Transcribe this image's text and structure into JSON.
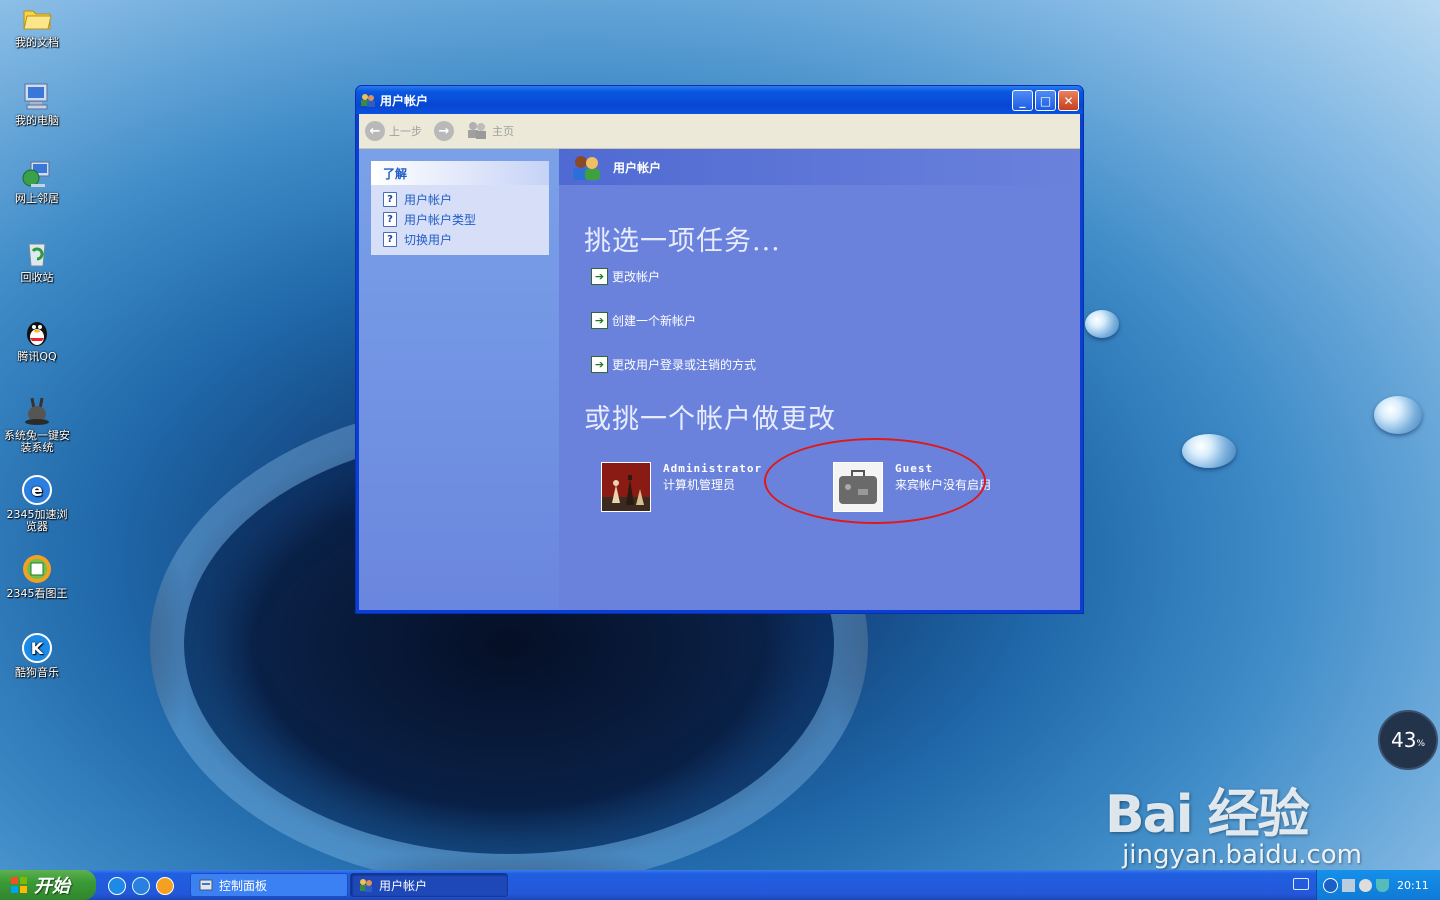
{
  "desktop": {
    "icons": [
      {
        "label": "我的文档"
      },
      {
        "label": "我的电脑"
      },
      {
        "label": "网上邻居"
      },
      {
        "label": "回收站"
      },
      {
        "label": "腾讯QQ"
      },
      {
        "label": "系统兔一键安装系统"
      },
      {
        "label": "2345加速浏览器"
      },
      {
        "label": "2345看图王"
      },
      {
        "label": "酷狗音乐"
      }
    ]
  },
  "window": {
    "title": "用户帐户",
    "toolbar": {
      "back_label": "上一步",
      "home_label": "主页"
    },
    "left_pane": {
      "learn_title": "了解",
      "items": [
        {
          "label": "用户帐户"
        },
        {
          "label": "用户帐户类型"
        },
        {
          "label": "切换用户"
        }
      ]
    },
    "header": "用户帐户",
    "pick_task": "挑选一项任务...",
    "tasks": [
      {
        "label": "更改帐户"
      },
      {
        "label": "创建一个新帐户"
      },
      {
        "label": "更改用户登录或注销的方式"
      }
    ],
    "pick_account": "或挑一个帐户做更改",
    "accounts": [
      {
        "name": "Administrator",
        "desc": "计算机管理员"
      },
      {
        "name": "Guest",
        "desc": "来宾帐户没有启用"
      }
    ]
  },
  "taskbar": {
    "start_label": "开始",
    "tasks": [
      {
        "label": "控制面板"
      },
      {
        "label": "用户帐户"
      }
    ],
    "clock": "20:11"
  },
  "gauge": {
    "value": "43",
    "unit": "%"
  },
  "watermark": {
    "url": "jingyan.baidu.com",
    "logo": "Bai 经验"
  }
}
